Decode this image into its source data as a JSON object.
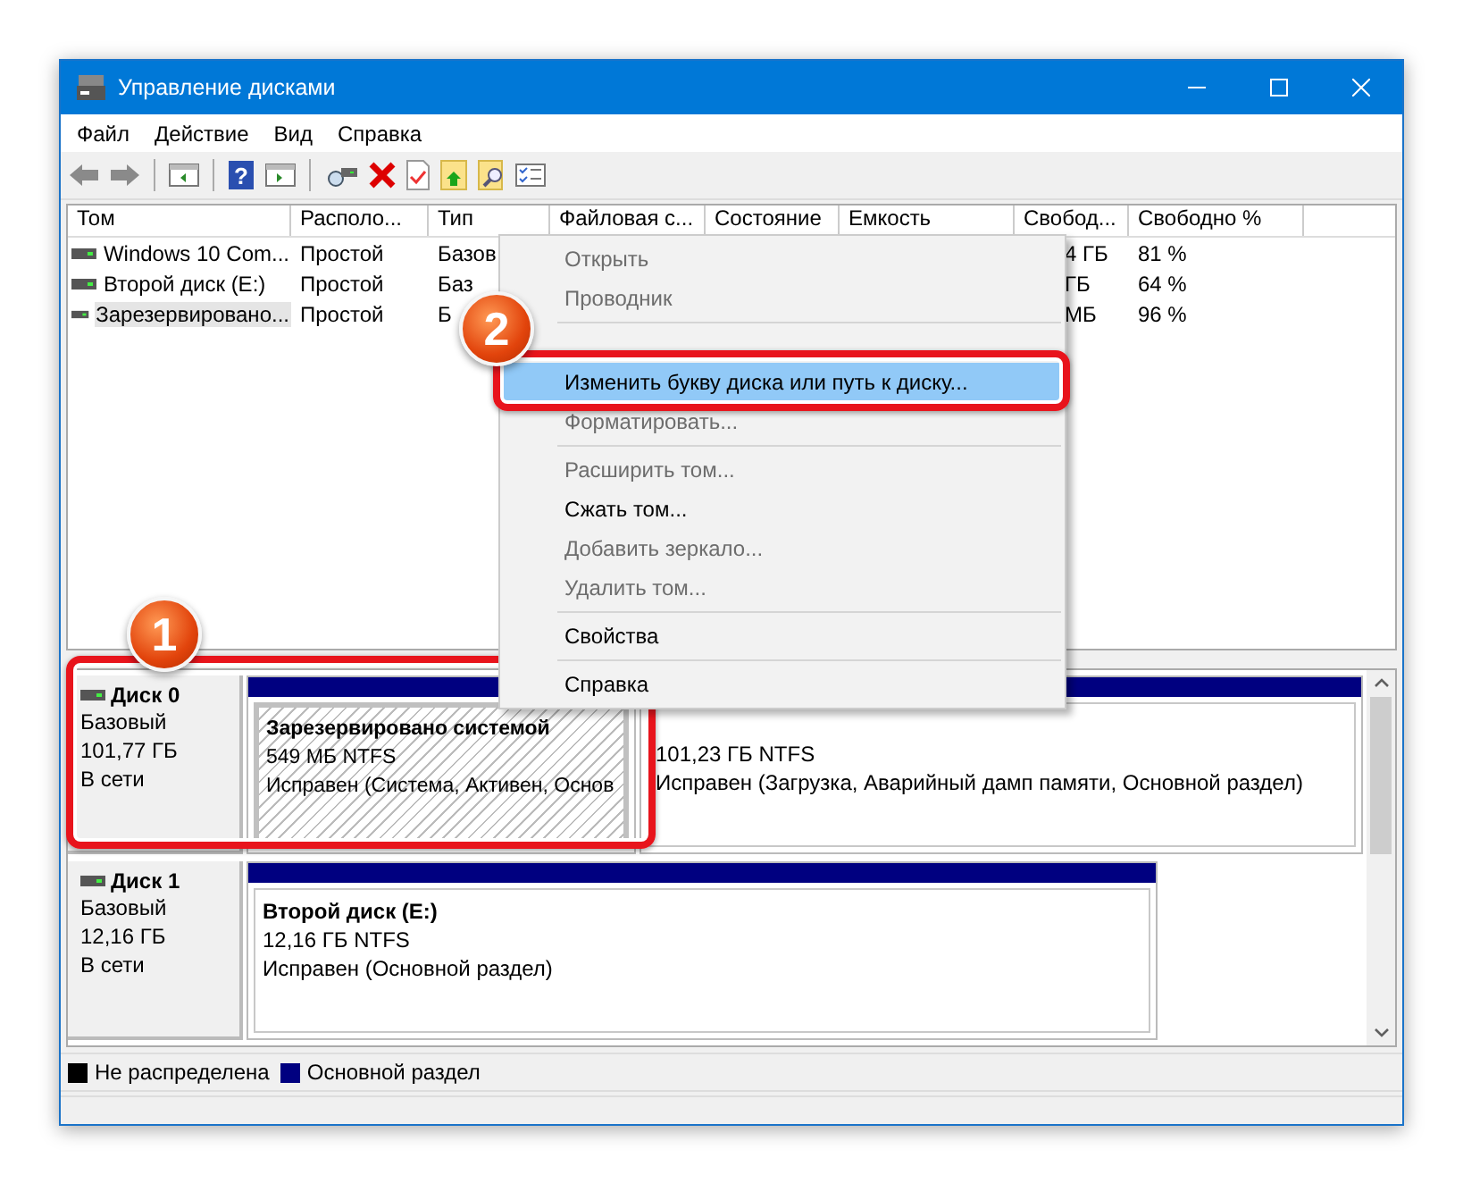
{
  "window": {
    "title": "Управление дисками"
  },
  "menu_bar": [
    "Файл",
    "Действие",
    "Вид",
    "Справка"
  ],
  "toolbar": {
    "help_glyph": "?"
  },
  "volume_table": {
    "columns": [
      "Том",
      "Располо...",
      "Тип",
      "Файловая с...",
      "Состояние",
      "Емкость",
      "Свобод...",
      "Свободно %"
    ],
    "rows": [
      {
        "volume": "Windows 10 Com...",
        "layout": "Простой",
        "type": "Базов",
        "free": "4 ГБ",
        "free_percent": "81 %",
        "selected": false
      },
      {
        "volume": "Второй диск (E:)",
        "layout": "Простой",
        "type": "Баз",
        "free": "ГБ",
        "free_percent": "64 %",
        "selected": false
      },
      {
        "volume": "Зарезервировано...",
        "layout": "Простой",
        "type": "Б",
        "free": "МБ",
        "free_percent": "96 %",
        "selected": true
      }
    ]
  },
  "context_menu": {
    "items": [
      {
        "kind": "item",
        "label": "Открыть",
        "disabled": true,
        "selected": false
      },
      {
        "kind": "item",
        "label": "Проводник",
        "disabled": true,
        "selected": false
      },
      {
        "kind": "separator"
      },
      {
        "kind": "item",
        "label": "Изменить букву диска или путь к диску...",
        "disabled": false,
        "selected": true
      },
      {
        "kind": "item",
        "label": "Форматировать...",
        "disabled": true,
        "selected": false
      },
      {
        "kind": "separator"
      },
      {
        "kind": "item",
        "label": "Расширить том...",
        "disabled": true,
        "selected": false
      },
      {
        "kind": "item",
        "label": "Сжать том...",
        "disabled": false,
        "selected": false
      },
      {
        "kind": "item",
        "label": "Добавить зеркало...",
        "disabled": true,
        "selected": false
      },
      {
        "kind": "item",
        "label": "Удалить том...",
        "disabled": true,
        "selected": false
      },
      {
        "kind": "separator"
      },
      {
        "kind": "item",
        "label": "Свойства",
        "disabled": false,
        "selected": false
      },
      {
        "kind": "separator"
      },
      {
        "kind": "item",
        "label": "Справка",
        "disabled": false,
        "selected": false
      }
    ]
  },
  "disks": [
    {
      "name": "Диск 0",
      "type": "Базовый",
      "size": "101,77 ГБ",
      "status": "В сети",
      "partitions": [
        {
          "name": "Зарезервировано системой",
          "size_fs": "549 МБ NTFS",
          "health": "Исправен (Система, Активен, Основ",
          "selected": true
        },
        {
          "size_fs": "101,23 ГБ NTFS",
          "health": "Исправен (Загрузка, Аварийный дамп памяти, Основной раздел)",
          "selected": false
        }
      ]
    },
    {
      "name": "Диск 1",
      "type": "Базовый",
      "size": "12,16 ГБ",
      "status": "В сети",
      "partitions": [
        {
          "name": "Второй диск  (E:)",
          "size_fs": "12,16 ГБ NTFS",
          "health": "Исправен (Основной раздел)",
          "selected": false
        }
      ]
    }
  ],
  "legend": [
    {
      "label": "Не распределена",
      "color": "#000000"
    },
    {
      "label": "Основной раздел",
      "color": "#000080"
    }
  ],
  "callouts": [
    "1",
    "2"
  ]
}
